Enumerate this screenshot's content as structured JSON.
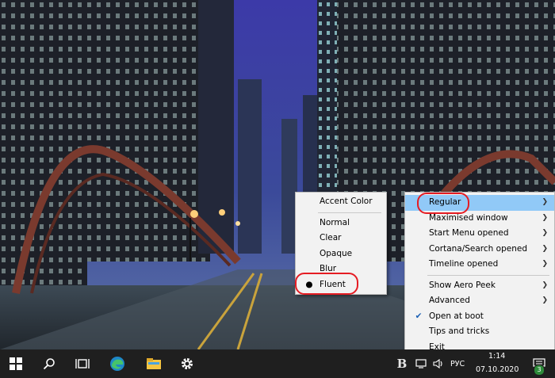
{
  "tray_menu": {
    "items": [
      {
        "label": "Regular",
        "submenu": true,
        "highlighted": true
      },
      {
        "label": "Maximised window",
        "submenu": true
      },
      {
        "label": "Start Menu opened",
        "submenu": true
      },
      {
        "label": "Cortana/Search opened",
        "submenu": true
      },
      {
        "label": "Timeline opened",
        "submenu": true
      },
      {
        "label": "Show Aero Peek",
        "submenu": true
      },
      {
        "label": "Advanced",
        "submenu": true
      },
      {
        "label": "Open at boot",
        "checked": true
      },
      {
        "label": "Tips and tricks"
      },
      {
        "label": "Exit"
      }
    ]
  },
  "accent_menu": {
    "header": "Accent Color",
    "items": [
      {
        "label": "Normal"
      },
      {
        "label": "Clear"
      },
      {
        "label": "Opaque"
      },
      {
        "label": "Blur"
      },
      {
        "label": "Fluent",
        "selected": true
      }
    ]
  },
  "taskbar": {
    "icons": [
      "windows-start-icon",
      "search-icon",
      "task-view-icon",
      "edge-icon",
      "file-explorer-icon",
      "settings-gear-icon"
    ],
    "tray": {
      "language": "РУС",
      "time": "1:14",
      "date": "07.10.2020",
      "notification_count": "3"
    }
  },
  "colors": {
    "menu_highlight": "#91c9f7",
    "annotation_red": "#e51c23",
    "taskbar": "#1f1f1f"
  }
}
